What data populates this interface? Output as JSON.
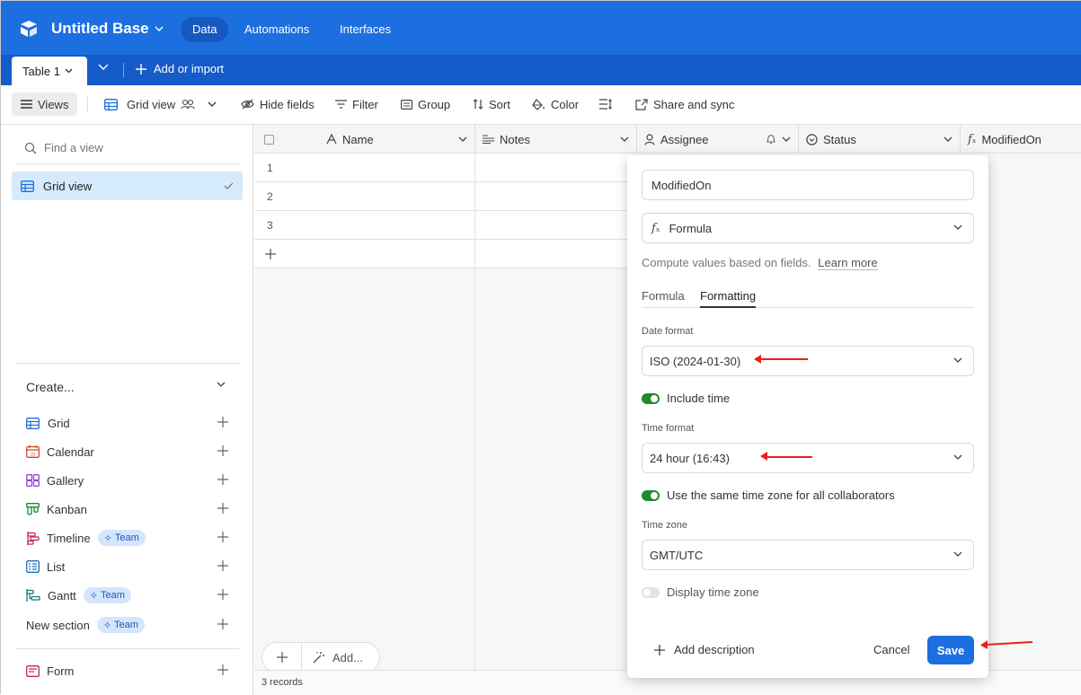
{
  "topbar": {
    "base_title": "Untitled Base",
    "tabs": [
      "Data",
      "Automations",
      "Interfaces"
    ]
  },
  "tablebar": {
    "table_tab": "Table 1",
    "add_import": "Add or import"
  },
  "toolbar": {
    "views": "Views",
    "grid_view": "Grid view",
    "hide_fields": "Hide fields",
    "filter": "Filter",
    "group": "Group",
    "sort": "Sort",
    "color": "Color",
    "share_sync": "Share and sync"
  },
  "sidebar": {
    "find_placeholder": "Find a view",
    "active_view": "Grid view",
    "create_title": "Create...",
    "create_items": [
      {
        "label": "Grid",
        "icon": "grid-icon"
      },
      {
        "label": "Calendar",
        "icon": "calendar-icon"
      },
      {
        "label": "Gallery",
        "icon": "gallery-icon"
      },
      {
        "label": "Kanban",
        "icon": "kanban-icon"
      },
      {
        "label": "Timeline",
        "icon": "timeline-icon",
        "badge": "Team"
      },
      {
        "label": "List",
        "icon": "list-icon"
      },
      {
        "label": "Gantt",
        "icon": "gantt-icon",
        "badge": "Team"
      }
    ],
    "new_section": "New section",
    "new_section_badge": "Team",
    "form": "Form"
  },
  "grid": {
    "columns": [
      "Name",
      "Notes",
      "Assignee",
      "Status",
      "ModifiedOn"
    ],
    "rows": [
      "1",
      "2",
      "3"
    ],
    "add_label": "Add...",
    "records": "3 records"
  },
  "popup": {
    "field_name": "ModifiedOn",
    "field_type": "Formula",
    "description": "Compute values based on fields.",
    "learn_more": "Learn more",
    "tabs": [
      "Formula",
      "Formatting"
    ],
    "active_tab": "Formatting",
    "date_format_label": "Date format",
    "date_format_value": "ISO (2024-01-30)",
    "include_time": "Include time",
    "include_time_on": true,
    "time_format_label": "Time format",
    "time_format_value": "24 hour (16:43)",
    "same_timezone": "Use the same time zone for all collaborators",
    "same_timezone_on": true,
    "time_zone_label": "Time zone",
    "time_zone_value": "GMT/UTC",
    "display_time_zone": "Display time zone",
    "display_time_zone_on": false,
    "add_description": "Add description",
    "cancel": "Cancel",
    "save": "Save"
  },
  "colors": {
    "brand_blue": "#1d6fe0",
    "annotation_arrow": "#e8201a",
    "toggle_on": "#1e8a2e"
  }
}
